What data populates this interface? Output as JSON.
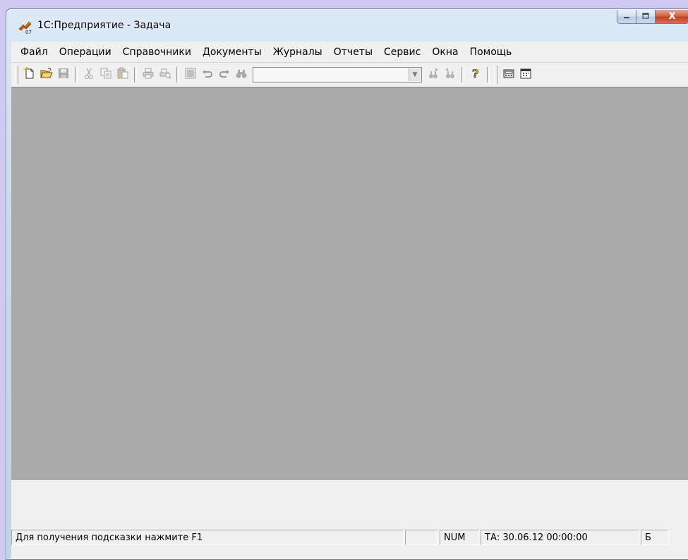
{
  "window": {
    "title": "1С:Предприятие - Задача",
    "close_glyph": "X"
  },
  "menu": [
    {
      "label": "Файл"
    },
    {
      "label": "Операции"
    },
    {
      "label": "Справочники"
    },
    {
      "label": "Документы"
    },
    {
      "label": "Журналы"
    },
    {
      "label": "Отчеты"
    },
    {
      "label": "Сервис"
    },
    {
      "label": "Окна"
    },
    {
      "label": "Помощь"
    }
  ],
  "toolbar": {
    "search_value": "",
    "icons": [
      "new-document-icon",
      "open-folder-icon",
      "save-icon",
      "cut-icon",
      "copy-icon",
      "paste-icon",
      "print-icon",
      "print-preview-icon",
      "properties-icon",
      "undo-icon",
      "redo-icon",
      "find-icon",
      "find-next-icon",
      "find-prev-icon",
      "help-icon",
      "calculator-icon",
      "calendar-icon"
    ]
  },
  "status": {
    "hint": "Для получения подсказки нажмите F1",
    "blank_pane": "",
    "num": "NUM",
    "ta": "ТА: 30.06.12  00:00:00",
    "kb_layout": "Б"
  },
  "colors": {
    "workspace": "#ababab",
    "chrome": "#f0f0f0",
    "close_button": "#c4401f"
  }
}
